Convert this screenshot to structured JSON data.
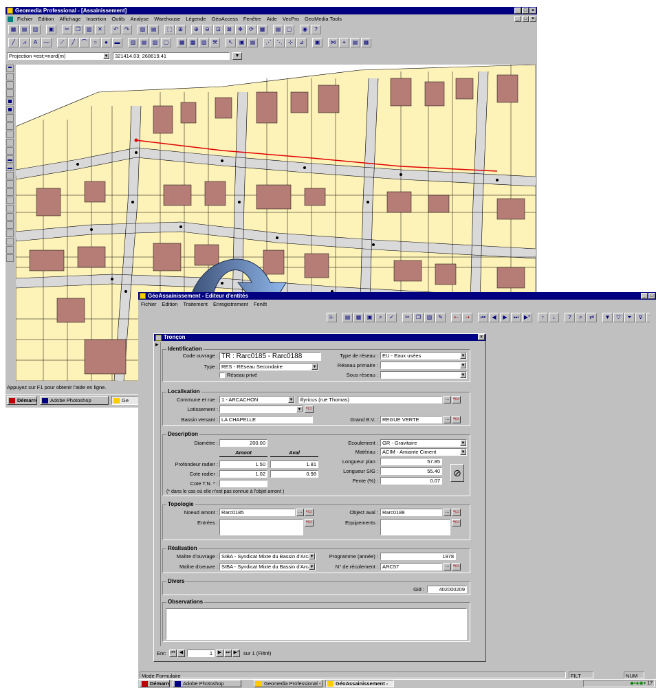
{
  "back_window": {
    "title": "Geomedia Professional - [Assainissement]",
    "menus": [
      "Fichier",
      "Edition",
      "Affichage",
      "Insertion",
      "Outils",
      "Analyse",
      "Warehouse",
      "Légende",
      "GéoAccess",
      "Fenêtre",
      "Aide",
      "VecPro",
      "GeoMedia Tools"
    ],
    "projection": "Projection =est;=nord(m)",
    "coords": "321414.03; 268619.41",
    "status": "Appuyez sur F1 pour obtenir l'aide en ligne.",
    "taskbar": {
      "start": "Démarrer",
      "items": [
        "Adobe Photoshop",
        "Ge"
      ]
    }
  },
  "front_window": {
    "title": "GéoAssainissement - Editeur d'entités",
    "menus": [
      "Fichier",
      "Edition",
      "Traitement",
      "Enregistrement",
      "Fenêt"
    ],
    "status": "Mode Formulaire",
    "status_panels": [
      "FILT",
      "NUM"
    ],
    "taskbar": {
      "start": "Démarrer",
      "items": [
        "Adobe Photoshop",
        "Geomedia Professional - [A",
        "GéoAssainissement -"
      ],
      "clock": "17"
    }
  },
  "form": {
    "title": "Tronçon",
    "identification": {
      "heading": "Identification",
      "code_label": "Code ouvrage :",
      "code_value": "TR : Rarc0185 - Rarc0188",
      "type_label": "Type :",
      "type_value": "RES - REseau Secondaire",
      "reseau_prive_label": "Réseau privé",
      "type_reseau_label": "Type de réseau :",
      "type_reseau_value": "EU - Eaux usées",
      "reseau_primaire_label": "Réseau primaire :",
      "reseau_primaire_value": "",
      "sous_reseau_label": "Sous réseau :",
      "sous_reseau_value": ""
    },
    "localisation": {
      "heading": "Localisation",
      "commune_label": "Commune et rue :",
      "commune_value": "1 - ARCACHON",
      "rue_value": "Illyricus (rue Thomas)",
      "lotissement_label": "Lotissement :",
      "lotissement_value": "",
      "bassin_label": "Bassin versant :",
      "bassin_value": "LA CHAPELLE",
      "grand_bv_label": "Grand B.V. :",
      "grand_bv_value": "REGUE VERTE"
    },
    "description": {
      "heading": "Description",
      "diametre_label": "Diamètre :",
      "diametre_value": "200.00",
      "amont_label": "Amont",
      "aval_label": "Aval",
      "prof_label": "Profondeur radier :",
      "prof_amont": "1.50",
      "prof_aval": "1.81",
      "cote_radier_label": "Cote radier :",
      "cote_radier_amont": "1.02",
      "cote_radier_aval": "0.98",
      "cote_tn_label": "Cote T.N. * :",
      "cote_tn_value": "",
      "note": "(* dans le cas où elle n'est pas connue à l'objet amont )",
      "ecoulement_label": "Ecoulement :",
      "ecoulement_value": "GR - Gravitaire",
      "materiau_label": "Matériau :",
      "materiau_value": "ACIM - Amiante Ciment",
      "longueur_plan_label": "Longueur plan :",
      "longueur_plan_value": "57.85",
      "longueur_sig_label": "Longueur SIG :",
      "longueur_sig_value": "55.40",
      "pente_label": "Pente (%) :",
      "pente_value": "0.07"
    },
    "topologie": {
      "heading": "Topologie",
      "noeud_amont_label": "Noeud amont :",
      "noeud_amont_value": "Rarc0185",
      "entrees_label": "Entrées :",
      "objet_aval_label": "Object aval :",
      "objet_aval_value": "Rarc0188",
      "equipements_label": "Equipements :"
    },
    "realisation": {
      "heading": "Réalisation",
      "mo_label": "Maître d'ouvrage :",
      "mo_value": "SIBA - Syndicat Mixte du Bassin d'Arcac",
      "moe_label": "Maître d'oeuvre :",
      "moe_value": "SIBA - Syndicat Mixte du Bassin d'Arcac",
      "programme_label": "Programme (année) :",
      "programme_value": "1978",
      "recolement_label": "N° de récolement :",
      "recolement_value": "ARC57"
    },
    "divers": {
      "heading": "Divers",
      "gid_label": "Gid :",
      "gid_value": "402000209"
    },
    "observations": {
      "heading": "Observations",
      "value": ""
    },
    "nav": {
      "label": "Enr:",
      "current": "1",
      "total": "sur 1 (Filtré)"
    }
  },
  "colors": {
    "title_bar": "#000080",
    "window": "#c0c0c0",
    "parcel": "#fdf2b8",
    "building": "#b57d76",
    "road": "#d9d9d9",
    "network_red": "#e00000",
    "arrow": "#5b86c2"
  },
  "icons": [
    "toolbar-icons",
    "curved-arrow",
    "link-icon"
  ]
}
